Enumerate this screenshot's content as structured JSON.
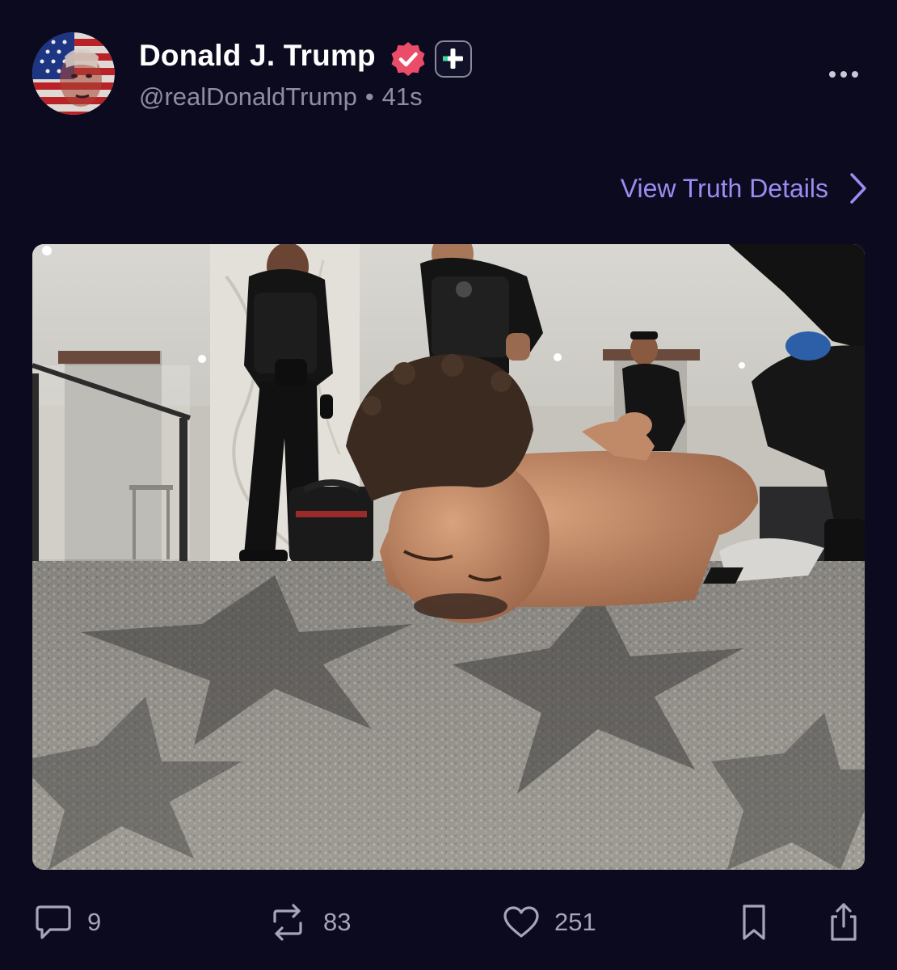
{
  "post": {
    "author": {
      "display_name": "Donald J. Trump",
      "handle": "@realDonaldTrump",
      "separator": "•",
      "timestamp": "41s"
    },
    "view_details_label": "View Truth Details",
    "stats": {
      "replies": "9",
      "retruths": "83",
      "likes": "251"
    },
    "image": {
      "alt": "Shirtless man lying face-down on a patterned carpet with hands behind his back while uniformed officers stand around him in a hotel lobby"
    }
  },
  "icons": {
    "verified": "verified-check-badge-icon",
    "plus": "plus-square-icon",
    "more": "more-horizontal-icon",
    "chevron": "chevron-right-icon",
    "reply": "speech-bubble-icon",
    "retruth": "repost-arrows-icon",
    "like": "heart-icon",
    "bookmark": "bookmark-icon",
    "share": "share-upload-icon"
  },
  "colors": {
    "background": "#0b0a1f",
    "accent": "#9a8df2",
    "verified_badge": "#ea4c6a",
    "plus_badge": "#3fd9a4",
    "muted_text": "#8e8ea2"
  }
}
